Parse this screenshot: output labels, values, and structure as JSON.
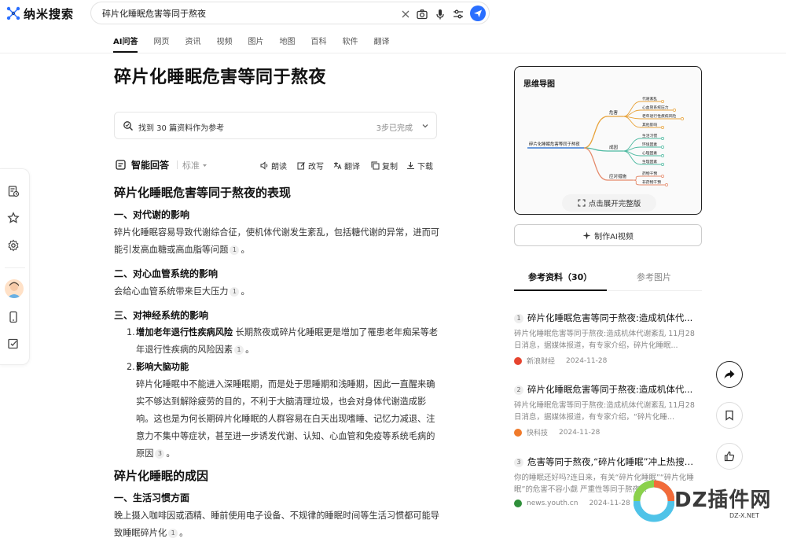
{
  "header": {
    "logo_text": "纳米搜索",
    "search": {
      "value": "碎片化睡眠危害等同于熬夜"
    },
    "tabs": [
      "AI问答",
      "网页",
      "资讯",
      "视频",
      "图片",
      "地图",
      "百科",
      "软件",
      "翻译"
    ],
    "active_tab": "AI问答"
  },
  "main": {
    "title": "碎片化睡眠危害等同于熬夜",
    "refs_text": "找到 30 篇资料作为参考",
    "refs_status": "3步已完成",
    "answer_label": "智能回答",
    "mode_label": "标准",
    "actions": [
      "朗读",
      "改写",
      "翻译",
      "复制",
      "下载"
    ],
    "sections": {
      "h_effects": "碎片化睡眠危害等同于熬夜的表现",
      "s1_title": "一、对代谢的影响",
      "s1_text": "碎片化睡眠容易导致代谢综合征，使机体代谢发生紊乱，包括糖代谢的异常，进而可能引发高血糖或高血脂等问题",
      "s1_cite": "1",
      "s2_title": "二、对心血管系统的影响",
      "s2_text": "会给心血管系统带来巨大压力",
      "s2_cite": "1",
      "s3_title": "三、对神经系统的影响",
      "item1_num": "1.",
      "item1_bold": "增加老年退行性疾病风险",
      "item1_text": " 长期熬夜或碎片化睡眠更是增加了罹患老年痴呆等老年退行性疾病的风险因素",
      "item1_cite": "1",
      "item2_num": "2.",
      "item2_bold": "影响大脑功能",
      "item2_text": "碎片化睡眠中不能进入深睡眠期，而是处于思睡期和浅睡期，因此一直醒来确实不够达到解除疲劳的目的，不利于大脑清理垃圾，也会对身体代谢造成影响。这也是为何长期碎片化睡眠的人群容易在白天出现嗜睡、记忆力减退、注意力不集中等症状，甚至进一步诱发代谢、认知、心血管和免疫等系统毛病的原因",
      "item2_cite": "3",
      "h_causes": "碎片化睡眠的成因",
      "c1_title": "一、生活习惯方面",
      "c1_text": "晚上摄入咖啡因或酒精、睡前使用电子设备、不规律的睡眠时间等生活习惯都可能导致睡眠碎片化",
      "c1_cite": "1"
    }
  },
  "mindmap": {
    "title": "思维导图",
    "root": "碎片化睡眠危害等同于熬夜",
    "branches": [
      {
        "label": "危害",
        "children": [
          "代谢紊乱",
          "心血管系统压力",
          "老年退行性疾病风险",
          "其他影响"
        ]
      },
      {
        "label": "成因",
        "children": [
          "生活习惯",
          "环境因素",
          "心理因素",
          "生理因素"
        ]
      },
      {
        "label": "应对措施",
        "children": [
          "药物干预",
          "非药物干预"
        ]
      }
    ],
    "expand_label": "点击展开完整版",
    "branch_colors": [
      "#e8a33b",
      "#4cb9a0",
      "#e58a6b"
    ]
  },
  "right": {
    "make_video": "制作AI视频",
    "tabs": [
      "参考资料（30）",
      "参考图片"
    ],
    "refs": [
      {
        "num": "1",
        "title": "碎片化睡眠危害等同于熬夜:造成机体代...",
        "desc": "碎片化睡眠危害等同于熬夜:造成机体代谢紊乱 11月28日消息，据媒体报道，有专家介绍，碎片化睡眠...",
        "source": "新浪财经",
        "date": "2024-11-28",
        "color": "#e6442f"
      },
      {
        "num": "2",
        "title": "碎片化睡眠危害等同于熬夜:造成机体代...",
        "desc": "碎片化睡眠危害等同于熬夜:造成机体代谢紊乱 11月28日消息，据媒体报道，有专家介绍，“碎片化睡...",
        "source": "快科技",
        "date": "2024-11-28",
        "color": "#f07a2a"
      },
      {
        "num": "3",
        "title": "危害等同于熬夜,“碎片化睡眠”冲上热搜!...",
        "desc": "你的睡眠还好吗?连日来，有关“碎片化睡眠”“碎片化睡眠”的危害不容小觑 严重性等同于熬夜...",
        "source": "news.youth.cn",
        "date": "2024-11-28",
        "color": "#2f8f3a"
      }
    ]
  },
  "watermark": {
    "big": "DZ插件网",
    "small": "DZ-X.NET"
  }
}
